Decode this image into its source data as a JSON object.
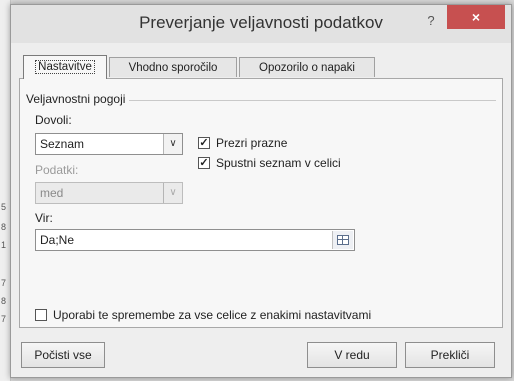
{
  "background": {
    "row_numbers": [
      "5",
      "8",
      "1",
      "7",
      "8",
      "7"
    ]
  },
  "dialog": {
    "title": "Preverjanje veljavnosti podatkov",
    "help_label": "?",
    "close_label": "×",
    "tabs": [
      {
        "label": "Nastavitve",
        "active": true
      },
      {
        "label": "Vhodno sporočilo",
        "active": false
      },
      {
        "label": "Opozorilo o napaki",
        "active": false
      }
    ],
    "settings": {
      "group_title": "Veljavnostni pogoji",
      "allow_label": "Dovoli:",
      "allow_value": "Seznam",
      "data_label": "Podatki:",
      "data_value": "med",
      "ignore_blank_label": "Prezri prazne",
      "ignore_blank_checked": true,
      "in_cell_dropdown_label": "Spustni seznam v celici",
      "in_cell_dropdown_checked": true,
      "source_label": "Vir:",
      "source_value": "Da;Ne",
      "apply_all_label": "Uporabi te spremembe za vse celice z enakimi nastavitvami",
      "apply_all_checked": false
    },
    "buttons": {
      "clear_all": "Počisti vse",
      "ok": "V redu",
      "cancel": "Prekliči"
    },
    "icons": {
      "dropdown": "chevron-down-icon",
      "range_selector": "collapse-range-icon",
      "check": "check-icon"
    },
    "colors": {
      "close_button": "#c75050",
      "dialog_bg": "#eeeeee",
      "panel_bg": "#f7f7f7"
    }
  }
}
